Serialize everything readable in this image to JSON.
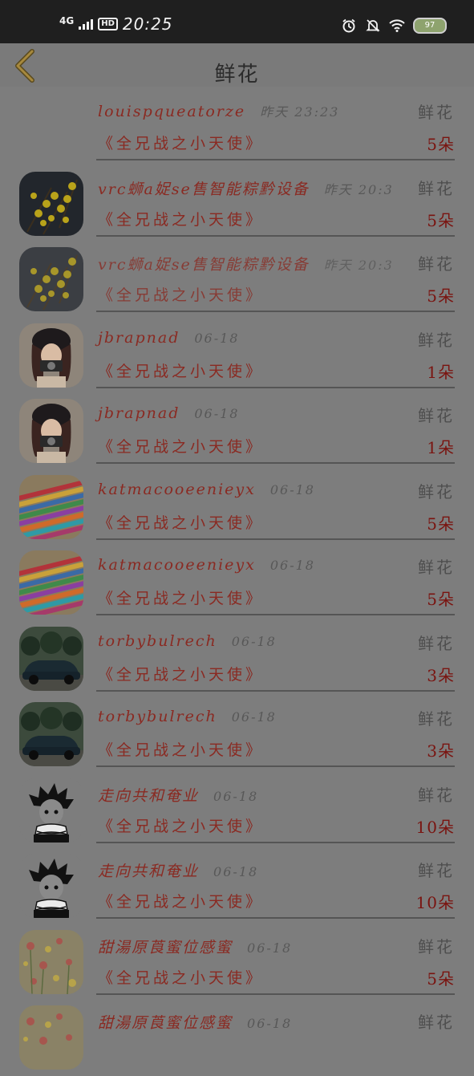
{
  "status_bar": {
    "network": "4G",
    "hd": "HD",
    "time": "20:25",
    "battery": "97"
  },
  "header": {
    "title": "鲜花"
  },
  "colors": {
    "name": "#8a2a22",
    "count": "#7a1410",
    "muted": "#585858"
  },
  "rows": [
    {
      "name": "louispqueatorze",
      "time": "昨天 23:23",
      "tag": "鲜花",
      "book": "《全兄战之小天使》",
      "count": "5朵",
      "avatar": "none"
    },
    {
      "name": "vrc蛳a娖se售智能粽黔设备",
      "time": "昨天 20:3",
      "tag": "鲜花",
      "book": "《全兄战之小天使》",
      "count": "5朵",
      "avatar": "yellow-flowers"
    },
    {
      "name": "vrc蛳a娖se售智能粽黔设备",
      "time": "昨天 20:3",
      "tag": "鲜花",
      "book": "《全兄战之小天使》",
      "count": "5朵",
      "avatar": "yellow-flowers"
    },
    {
      "name": "jbrapnad",
      "time": "06-18",
      "tag": "鲜花",
      "book": "《全兄战之小天使》",
      "count": "1朵",
      "avatar": "girl-camera"
    },
    {
      "name": "jbrapnad",
      "time": "06-18",
      "tag": "鲜花",
      "book": "《全兄战之小天使》",
      "count": "1朵",
      "avatar": "girl-camera"
    },
    {
      "name": "katmacooeenieyx",
      "time": "06-18",
      "tag": "鲜花",
      "book": "《全兄战之小天使》",
      "count": "5朵",
      "avatar": "pencils"
    },
    {
      "name": "katmacooeenieyx",
      "time": "06-18",
      "tag": "鲜花",
      "book": "《全兄战之小天使》",
      "count": "5朵",
      "avatar": "pencils"
    },
    {
      "name": "torbybulrech",
      "time": "06-18",
      "tag": "鲜花",
      "book": "《全兄战之小天使》",
      "count": "3朵",
      "avatar": "vintage-car"
    },
    {
      "name": "torbybulrech",
      "time": "06-18",
      "tag": "鲜花",
      "book": "《全兄战之小天使》",
      "count": "3朵",
      "avatar": "vintage-car"
    },
    {
      "name": "走向共和奄业",
      "time": "06-18",
      "tag": "鲜花",
      "book": "《全兄战之小天使》",
      "count": "10朵",
      "avatar": "anime-boy"
    },
    {
      "name": "走向共和奄业",
      "time": "06-18",
      "tag": "鲜花",
      "book": "《全兄战之小天使》",
      "count": "10朵",
      "avatar": "anime-boy"
    },
    {
      "name": "甜湯原莨蜜位感蜜",
      "time": "06-18",
      "tag": "鲜花",
      "book": "《全兄战之小天使》",
      "count": "5朵",
      "avatar": "pink-flowers"
    },
    {
      "name": "甜湯原莨蜜位感蜜",
      "time": "06-18",
      "tag": "鲜花",
      "book": "",
      "count": "",
      "avatar": "pink-flowers"
    }
  ]
}
